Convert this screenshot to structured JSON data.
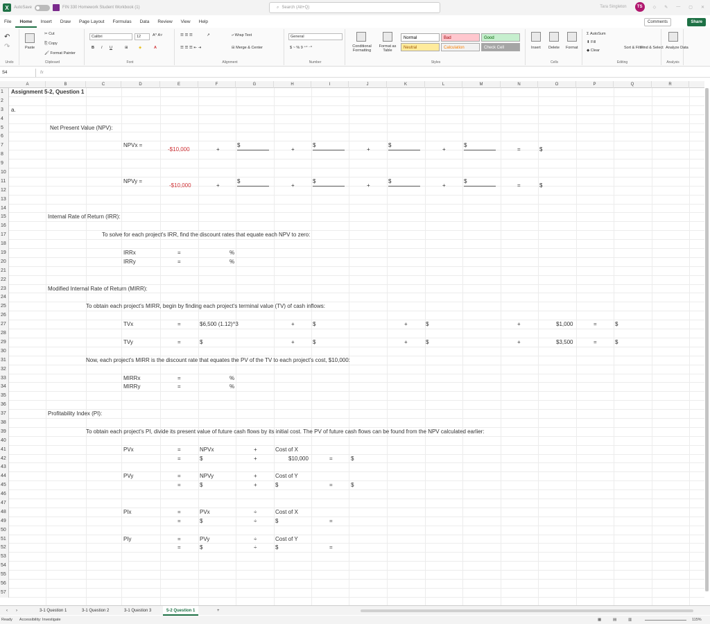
{
  "titlebar": {
    "autosave_label": "AutoSave",
    "autosave_state": "Off",
    "filename": "FIN 330 Homework Student Workbook (1)",
    "search_placeholder": "Search (Alt+Q)",
    "user_name": "Tara Singleton",
    "user_initials": "TS"
  },
  "menu": {
    "tabs": [
      "File",
      "Home",
      "Insert",
      "Draw",
      "Page Layout",
      "Formulas",
      "Data",
      "Review",
      "View",
      "Help"
    ],
    "active": "Home",
    "comments_label": "Comments",
    "share_label": "Share"
  },
  "ribbon": {
    "clipboard": {
      "paste": "Paste",
      "cut": "Cut",
      "copy": "Copy",
      "format_painter": "Format Painter",
      "label": "Clipboard",
      "undo_label": "Undo"
    },
    "font": {
      "name": "Calibri",
      "size": "12",
      "label": "Font"
    },
    "alignment": {
      "wrap": "Wrap Text",
      "merge": "Merge & Center",
      "label": "Alignment"
    },
    "number": {
      "format": "General",
      "label": "Number"
    },
    "styles": {
      "conditional": "Conditional Formatting",
      "format_table": "Format as Table",
      "cells": [
        {
          "name": "Normal",
          "bg": "#ffffff",
          "fg": "#000000"
        },
        {
          "name": "Bad",
          "bg": "#ffc7ce",
          "fg": "#9c0006"
        },
        {
          "name": "Good",
          "bg": "#c6efce",
          "fg": "#006100"
        },
        {
          "name": "Neutral",
          "bg": "#ffeb9c",
          "fg": "#9c5700"
        },
        {
          "name": "Calculation",
          "bg": "#f2f2f2",
          "fg": "#fa7d00"
        },
        {
          "name": "Check Cell",
          "bg": "#a5a5a5",
          "fg": "#ffffff"
        }
      ],
      "label": "Styles"
    },
    "cells": {
      "insert": "Insert",
      "delete": "Delete",
      "format": "Format",
      "label": "Cells"
    },
    "editing": {
      "autosum": "AutoSum",
      "fill": "Fill",
      "clear": "Clear",
      "sort": "Sort & Filter",
      "find": "Find & Select",
      "label": "Editing"
    },
    "analysis": {
      "analyze": "Analyze Data",
      "label": "Analysis"
    }
  },
  "formula_bar": {
    "name_box": "S4",
    "fx": "fx",
    "content": ""
  },
  "columns": [
    "A",
    "B",
    "C",
    "D",
    "E",
    "F",
    "G",
    "H",
    "I",
    "J",
    "K",
    "L",
    "M",
    "N",
    "O",
    "P",
    "Q",
    "R"
  ],
  "row_numbers": [
    "1",
    "2",
    "3",
    "4",
    "5",
    "6",
    "7",
    "8",
    "9",
    "10",
    "11",
    "12",
    "13",
    "14",
    "15",
    "16",
    "17",
    "18",
    "19",
    "20",
    "21",
    "22",
    "23",
    "24",
    "25",
    "26",
    "27",
    "28",
    "29",
    "30",
    "31",
    "32",
    "33",
    "34",
    "35",
    "36",
    "37",
    "38",
    "39",
    "40",
    "41",
    "42",
    "43",
    "44",
    "45",
    "46",
    "47",
    "48",
    "49",
    "50",
    "51",
    "52",
    "53",
    "54",
    "55",
    "56",
    "57"
  ],
  "cells": {
    "r1_title": "Assignment 5-2, Question 1",
    "r3_a": "a.",
    "r5_npv": "Net Present Value (NPV):",
    "r7_npvx": "NPVx =",
    "r7_e": "-$10,000",
    "plus": "+",
    "dollar": "$",
    "eq": "=",
    "r11_npvy": "NPVy =",
    "r11_e": "-$10,000",
    "r15_irr": "Internal Rate of Return (IRR):",
    "r17_text": "To solve for each project's IRR, find the discount rates that equate each NPV to zero:",
    "r19_irrx": "IRRx",
    "r20_irry": "IRRy",
    "pct": "%",
    "r23_mirr": "Modified Internal Rate of Return (MIRR):",
    "r25_text": "To obtain each project's MIRR, begin by finding each project's terminal value (TV) of cash inflows:",
    "r27_tvx": "TVx",
    "r27_f": "$6,500 (1.12)^3",
    "r27_o": "$1,000",
    "r29_tvy": "TVy",
    "r29_o": "$3,500",
    "r31_text": "Now, each project's MIRR is the discount rate that equates the PV of the TV to each project's cost, $10,000:",
    "r33_mirrx": "MIRRx",
    "r34_mirry": "MIRRy",
    "r37_pi": "Profitability Index (PI):",
    "r39_text": "To obtain each project's PI, divide its present value of future cash flows by its initial cost. The PV of future cash flows can be found from the NPV calculated earlier:",
    "r41_pvx": "PVx",
    "r41_f": "NPVx",
    "r41_h": "Cost of X",
    "r42_h": "$10,000",
    "r44_pvy": "PVy",
    "r44_f": "NPVy",
    "r44_h": "Cost of Y",
    "r48_pix": "PIx",
    "r48_f": "PVx",
    "div": "÷",
    "r48_h": "Cost of X",
    "r51_piy": "PIy",
    "r51_f": "PVy",
    "r51_h": "Cost of Y"
  },
  "sheets": {
    "tabs": [
      "3-1 Question 1",
      "3-1 Question 2",
      "3-1 Question 3",
      "5-2 Question 1"
    ],
    "active": "5-2 Question 1",
    "add": "+"
  },
  "status": {
    "ready": "Ready",
    "accessibility": "Accessibility: Investigate",
    "zoom": "115%"
  }
}
